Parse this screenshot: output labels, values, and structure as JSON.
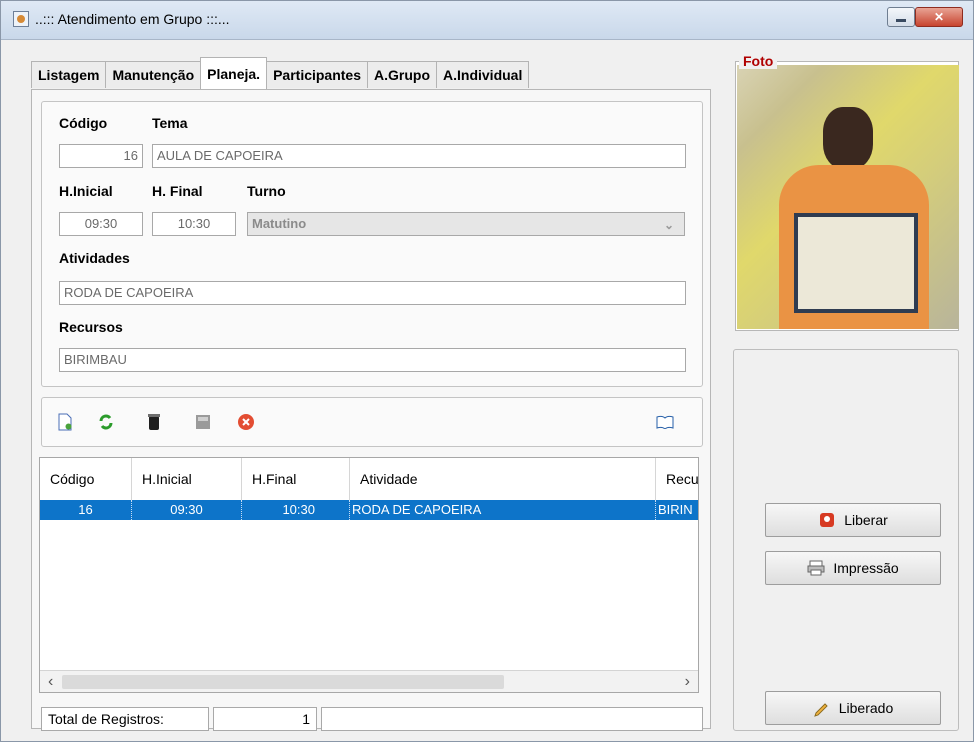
{
  "window": {
    "title": "..::: Atendimento em Grupo :::..."
  },
  "tabs": [
    {
      "label": "Listagem"
    },
    {
      "label": "Manutenção"
    },
    {
      "label": "Planeja."
    },
    {
      "label": "Participantes"
    },
    {
      "label": "A.Grupo"
    },
    {
      "label": "A.Individual"
    }
  ],
  "form": {
    "codigo": {
      "label": "Código",
      "value": "16"
    },
    "tema": {
      "label": "Tema",
      "value": "AULA DE CAPOEIRA"
    },
    "h_inicial": {
      "label": "H.Inicial",
      "value": "09:30"
    },
    "h_final": {
      "label": "H. Final",
      "value": "10:30"
    },
    "turno": {
      "label": "Turno",
      "value": "Matutino"
    },
    "atividades": {
      "label": "Atividades",
      "value": "RODA DE CAPOEIRA"
    },
    "recursos": {
      "label": "Recursos",
      "value": "BIRIMBAU"
    }
  },
  "table": {
    "columns": [
      "Código",
      "H.Inicial",
      "H.Final",
      "Atividade",
      "Recu"
    ],
    "rows": [
      {
        "codigo": "16",
        "h_inicial": "09:30",
        "h_final": "10:30",
        "atividade": "RODA DE CAPOEIRA",
        "recursos": "BIRIN"
      }
    ]
  },
  "status": {
    "label": "Total de Registros:",
    "count": "1"
  },
  "foto": {
    "legend": "Foto"
  },
  "buttons": {
    "liberar": "Liberar",
    "impressao": "Impressão",
    "liberado": "Liberado"
  },
  "colors": {
    "selection": "#0d74c9",
    "foto_label": "#b00000"
  },
  "icons": {
    "new": "new-document-icon",
    "refresh": "refresh-icon",
    "delete": "trash-icon",
    "save": "save-icon",
    "cancel": "cancel-icon",
    "help": "book-icon"
  }
}
